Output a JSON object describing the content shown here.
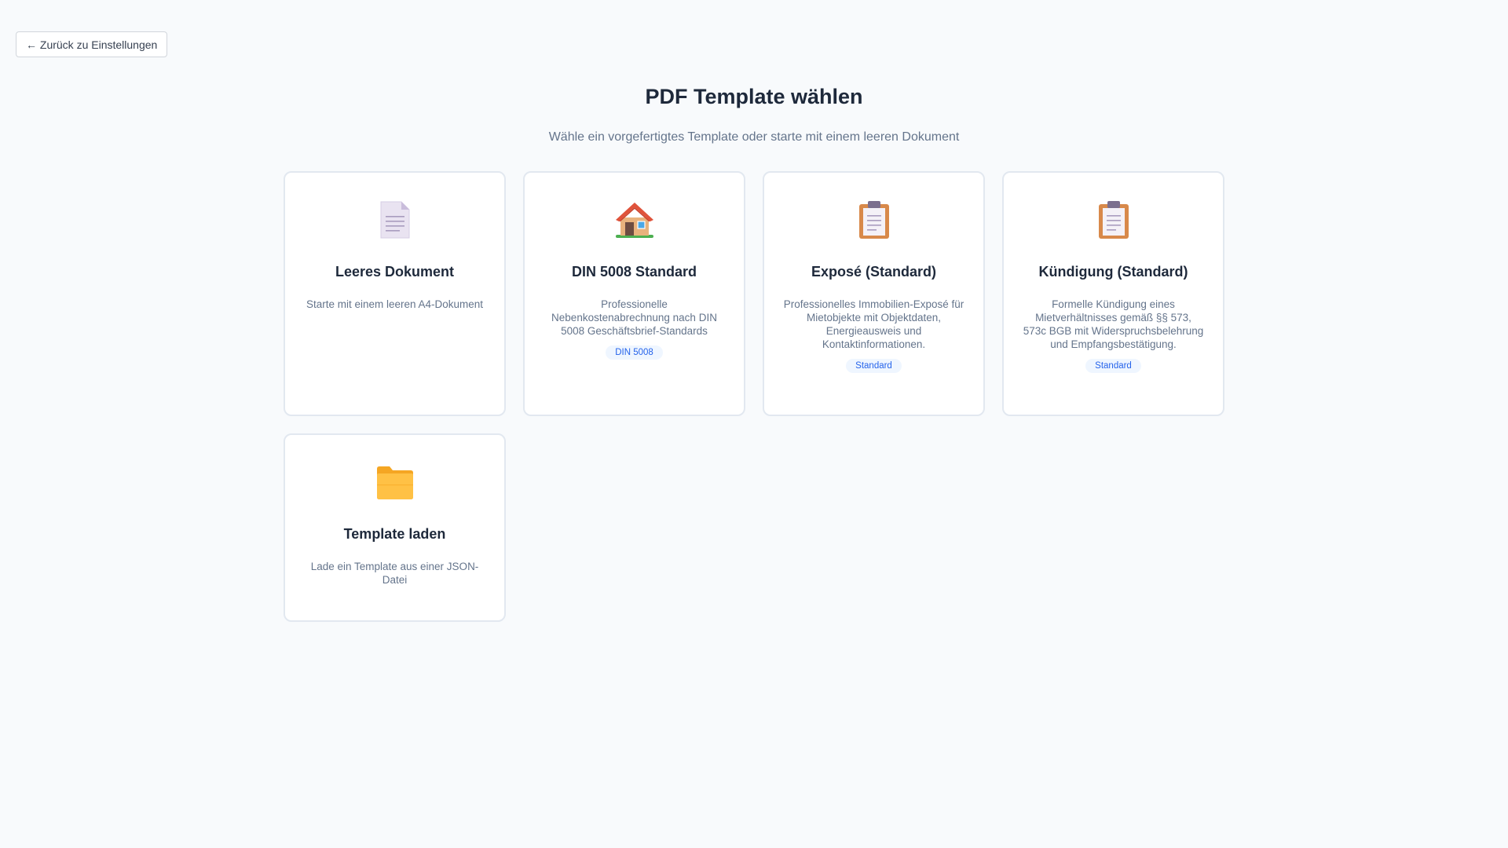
{
  "back_button": {
    "label": "← Zurück zu Einstellungen"
  },
  "header": {
    "title": "PDF Template wählen",
    "subtitle": "Wähle ein vorgefertigtes Template oder starte mit einem leeren Dokument"
  },
  "templates": [
    {
      "icon": "document-icon",
      "title": "Leeres Dokument",
      "description": "Starte mit einem leeren A4-Dokument",
      "badge": ""
    },
    {
      "icon": "house-icon",
      "title": "DIN 5008 Standard",
      "description": "Professionelle Nebenkostenabrechnung nach DIN 5008 Geschäftsbrief-Standards",
      "badge": "DIN 5008"
    },
    {
      "icon": "clipboard-icon",
      "title": "Exposé (Standard)",
      "description": "Professionelles Immobilien-Exposé für Mietobjekte mit Objektdaten, Energieausweis und Kontaktinformationen.",
      "badge": "Standard"
    },
    {
      "icon": "clipboard-icon",
      "title": "Kündigung (Standard)",
      "description": "Formelle Kündigung eines Mietverhältnisses gemäß §§ 573, 573c BGB mit Widerspruchsbelehrung und Empfangsbestätigung.",
      "badge": "Standard"
    },
    {
      "icon": "folder-icon",
      "title": "Template laden",
      "description": "Lade ein Template aus einer JSON-Datei",
      "badge": ""
    }
  ],
  "colors": {
    "background": "#f8fafc",
    "card_border": "#e2e8f0",
    "badge_bg": "#eff6ff",
    "badge_text": "#2563eb",
    "title_text": "#1e293b",
    "muted_text": "#64748b"
  }
}
